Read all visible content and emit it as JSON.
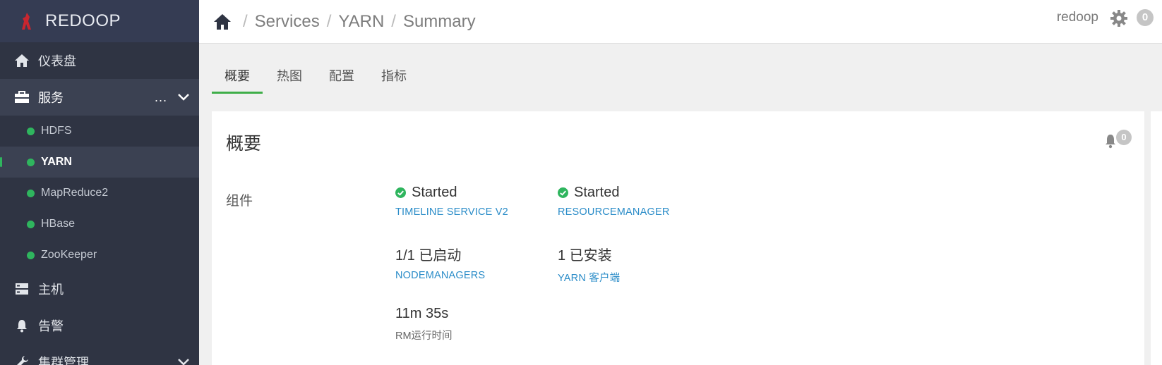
{
  "brand": {
    "name": "REDOOP"
  },
  "sidebar": {
    "dashboard": "仪表盘",
    "services": {
      "label": "服务",
      "more": "..."
    },
    "service_items": [
      "HDFS",
      "YARN",
      "MapReduce2",
      "HBase",
      "ZooKeeper"
    ],
    "hosts": "主机",
    "alerts": "告警",
    "cluster_admin": "集群管理"
  },
  "breadcrumb": {
    "sep": "/",
    "items": [
      "Services",
      "YARN",
      "Summary"
    ]
  },
  "user": {
    "name": "redoop",
    "notif_count": "0"
  },
  "tabs": [
    "概要",
    "热图",
    "配置",
    "指标"
  ],
  "panel": {
    "title": "概要",
    "alert_count": "0",
    "section_label": "组件",
    "components": {
      "timeline": {
        "status": "Started",
        "name": "TIMELINE SERVICE V2"
      },
      "rm": {
        "status": "Started",
        "name": "RESOURCEMANAGER"
      },
      "nm": {
        "status": "1/1 已启动",
        "name": "NODEMANAGERS"
      },
      "client": {
        "status": "1 已安装",
        "name": "YARN 客户端"
      },
      "uptime": {
        "value": "11m 35s",
        "label": "RM运行时间"
      }
    }
  },
  "colors": {
    "sidebar_bg": "#2f3443",
    "brand_bg": "#353c53",
    "accent_green": "#3fae49",
    "status_green": "#2fb55e",
    "link_blue": "#2a8cc8"
  }
}
